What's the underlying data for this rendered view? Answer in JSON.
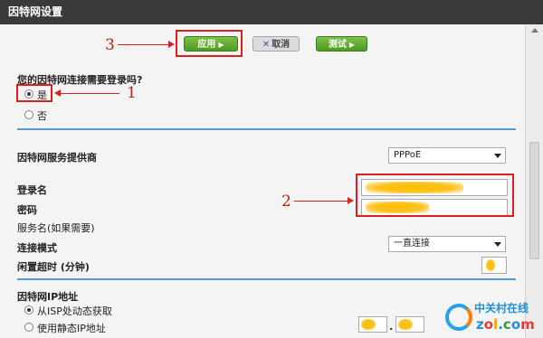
{
  "window": {
    "title": "因特网设置"
  },
  "toolbar": {
    "apply_label": "应用",
    "cancel_label": "取消",
    "test_label": "测试"
  },
  "question": {
    "label": "您的因特网连接需要登录吗?",
    "options": [
      {
        "label": "是",
        "selected": true
      },
      {
        "label": "否",
        "selected": false
      }
    ]
  },
  "isp": {
    "label": "因特网服务提供商",
    "value": "PPPoE"
  },
  "login": {
    "username_label": "登录名",
    "password_label": "密码",
    "service_label": "服务名(如果需要)",
    "mode_label": "连接模式",
    "mode_value": "一直连接",
    "idle_label": "闲置超时 (分钟)"
  },
  "ip": {
    "section_label": "因特网IP地址",
    "options": [
      {
        "label": "从ISP处动态获取",
        "selected": true
      },
      {
        "label": "使用静态IP地址",
        "selected": false
      }
    ]
  },
  "annotations": {
    "one": "1",
    "two": "2",
    "three": "3"
  },
  "watermark": {
    "text": "中关村在线",
    "url": "zol.com.cn"
  },
  "colors": {
    "accent_blue": "#5b97cf",
    "annotation_red": "#d92020",
    "button_green": "#5ea82c",
    "titlebar": "#3a3a3a"
  }
}
